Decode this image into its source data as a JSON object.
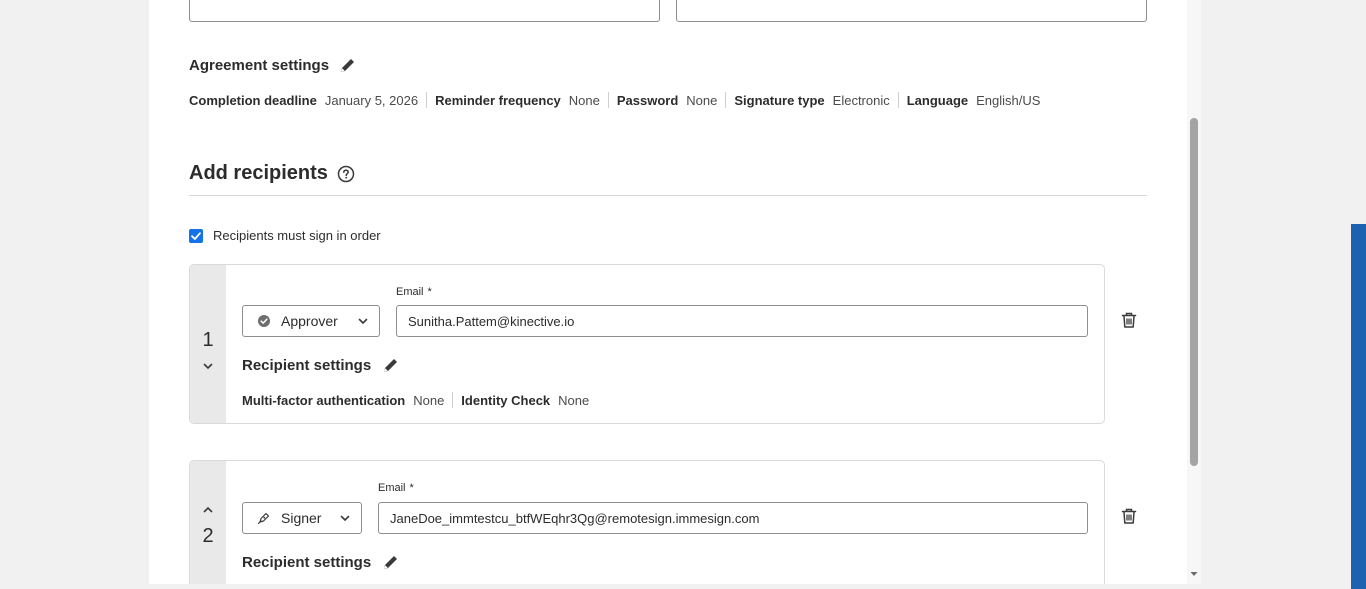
{
  "agreement_settings": {
    "title": "Agreement settings",
    "items": [
      {
        "key": "Completion deadline",
        "value": "January 5, 2026"
      },
      {
        "key": "Reminder frequency",
        "value": "None"
      },
      {
        "key": "Password",
        "value": "None"
      },
      {
        "key": "Signature type",
        "value": "Electronic"
      },
      {
        "key": "Language",
        "value": "English/US"
      }
    ]
  },
  "add_recipients": {
    "title": "Add recipients",
    "sign_in_order_label": "Recipients must sign in order",
    "sign_in_order_checked": true
  },
  "recipients": [
    {
      "number": "1",
      "role": "Approver",
      "email_label": "Email",
      "required_mark": "*",
      "email": "Sunitha.Pattem@kinective.io",
      "settings_title": "Recipient settings",
      "settings": [
        {
          "key": "Multi-factor authentication",
          "value": "None"
        },
        {
          "key": "Identity Check",
          "value": "None"
        }
      ]
    },
    {
      "number": "2",
      "role": "Signer",
      "email_label": "Email",
      "required_mark": "*",
      "email": "JaneDoe_immtestcu_btfWEqhr3Qg@remotesign.immesign.com",
      "settings_title": "Recipient settings"
    }
  ],
  "colors": {
    "accent": "#1473e6",
    "side_strip": "#1d62b0"
  }
}
